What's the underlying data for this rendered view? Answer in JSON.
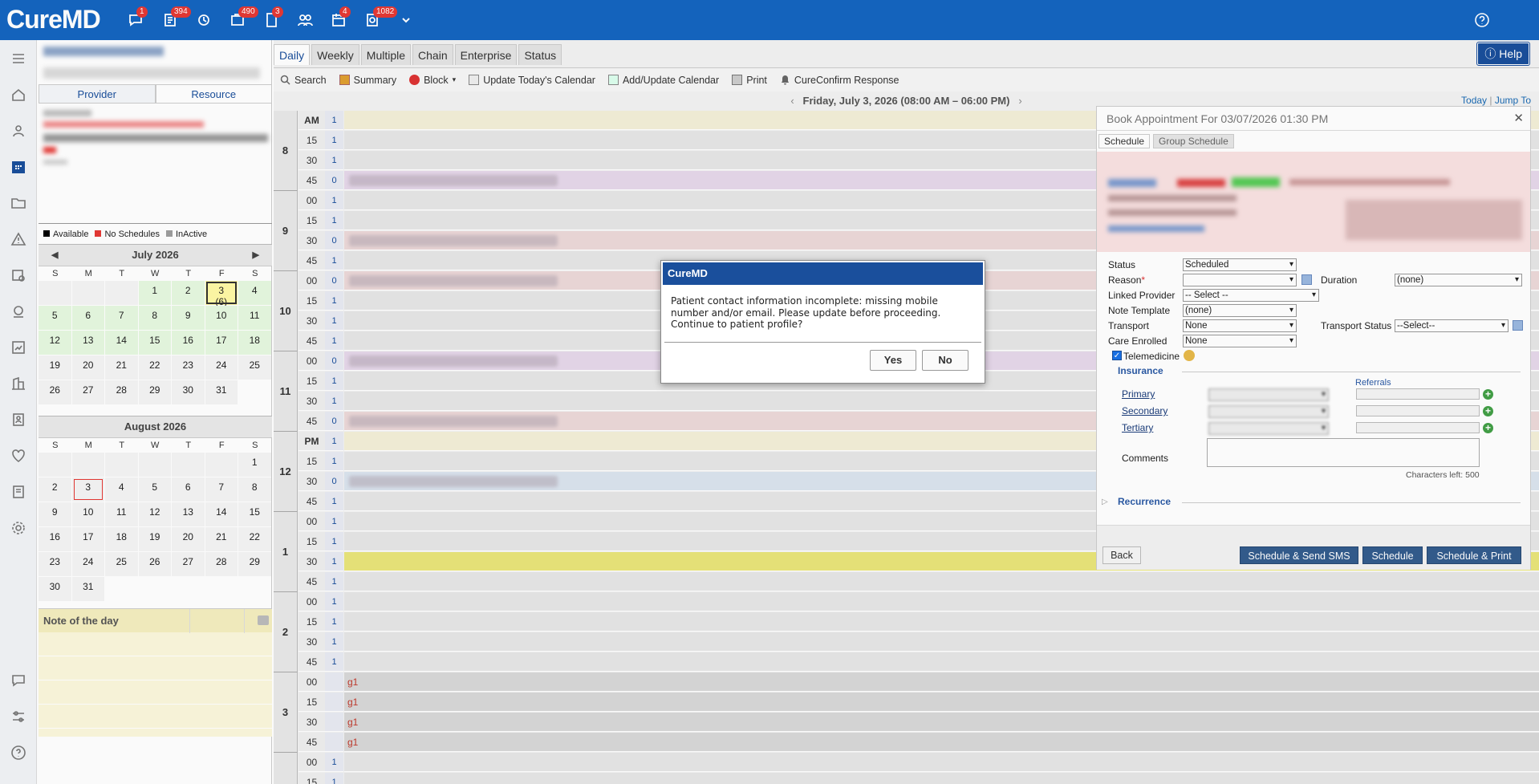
{
  "app": {
    "logo": "CureMD"
  },
  "topbar": {
    "badges": [
      "1",
      "394",
      "",
      "490",
      "3",
      "",
      "4",
      "1082"
    ]
  },
  "left": {
    "tabs": {
      "provider": "Provider",
      "resource": "Resource"
    },
    "legend": {
      "available": "Available",
      "no_schedules": "No Schedules",
      "inactive": "InActive"
    },
    "colors": {
      "available": "#000000",
      "no_schedules": "#e53935",
      "inactive": "#9e9e9e"
    },
    "july": {
      "title": "July 2026",
      "dow": [
        "S",
        "M",
        "T",
        "W",
        "T",
        "F",
        "S"
      ],
      "selected_count": "(6)"
    },
    "august": {
      "title": "August 2026",
      "dow": [
        "S",
        "M",
        "T",
        "W",
        "T",
        "F",
        "S"
      ]
    },
    "note_title": "Note of the day"
  },
  "main": {
    "view_tabs": [
      "Daily",
      "Weekly",
      "Multiple",
      "Chain",
      "Enterprise",
      "Status"
    ],
    "help": "Help",
    "toolbar": [
      "Search",
      "Summary",
      "Block",
      "Update Today's Calendar",
      "Add/Update Calendar",
      "Print",
      "CureConfirm Response"
    ],
    "date": "Friday, July 3, 2026 (08:00 AM – 06:00 PM)",
    "today_link": "Today",
    "jump_link": "Jump To"
  },
  "schedule": {
    "g1": "g1",
    "hours": [
      {
        "label": "8",
        "rows": [
          [
            "AM",
            "1"
          ],
          [
            "15",
            "1"
          ],
          [
            "30",
            "1"
          ],
          [
            "45",
            "0"
          ]
        ]
      },
      {
        "label": "9",
        "rows": [
          [
            "00",
            "1"
          ],
          [
            "15",
            "1"
          ],
          [
            "30",
            "0"
          ],
          [
            "45",
            "1"
          ]
        ]
      },
      {
        "label": "10",
        "rows": [
          [
            "00",
            "0"
          ],
          [
            "15",
            "1"
          ],
          [
            "30",
            "1"
          ],
          [
            "45",
            "1"
          ]
        ]
      },
      {
        "label": "11",
        "rows": [
          [
            "00",
            "0"
          ],
          [
            "15",
            "1"
          ],
          [
            "30",
            "1"
          ],
          [
            "45",
            "0"
          ]
        ]
      },
      {
        "label": "12",
        "rows": [
          [
            "PM",
            "1"
          ],
          [
            "15",
            "1"
          ],
          [
            "30",
            "0"
          ],
          [
            "45",
            "1"
          ]
        ]
      },
      {
        "label": "1",
        "rows": [
          [
            "00",
            "1"
          ],
          [
            "15",
            "1"
          ],
          [
            "30",
            "1"
          ],
          [
            "45",
            "1"
          ]
        ]
      },
      {
        "label": "2",
        "rows": [
          [
            "00",
            "1"
          ],
          [
            "15",
            "1"
          ],
          [
            "30",
            "1"
          ],
          [
            "45",
            "1"
          ]
        ]
      },
      {
        "label": "3",
        "rows": [
          [
            "00",
            ""
          ],
          [
            "15",
            ""
          ],
          [
            "30",
            ""
          ],
          [
            "45",
            ""
          ]
        ]
      },
      {
        "label": "",
        "rows": [
          [
            "00",
            "1"
          ],
          [
            "15",
            "1"
          ]
        ]
      }
    ]
  },
  "book": {
    "title": "Book Appointment For 03/07/2026 01:30 PM",
    "tabs": [
      "Schedule",
      "Group Schedule"
    ],
    "status_label": "Status",
    "status_value": "Scheduled",
    "reason_label": "Reason",
    "required_mark": "*",
    "duration_label": "Duration",
    "duration_value": "(none)",
    "linked_label": "Linked Provider",
    "linked_value": "-- Select --",
    "note_label": "Note Template",
    "note_value": "(none)",
    "transport_label": "Transport",
    "transport_value": "None",
    "tstatus_label": "Transport Status",
    "tstatus_value": "--Select--",
    "care_label": "Care Enrolled",
    "care_value": "None",
    "telemed_label": "Telemedicine",
    "insurance_label": "Insurance",
    "referrals_label": "Referrals",
    "primary": "Primary",
    "secondary": "Secondary",
    "tertiary": "Tertiary",
    "comments_label": "Comments",
    "chars_left": "Characters left: 500",
    "recurrence": "Recurrence",
    "back": "Back",
    "btn_sms": "Schedule & Send SMS",
    "btn_schedule": "Schedule",
    "btn_print": "Schedule & Print"
  },
  "dialog": {
    "title": "CureMD",
    "message": "Patient contact information incomplete: missing mobile number and/or email. Please update before proceeding. Continue to patient profile?",
    "yes": "Yes",
    "no": "No"
  }
}
